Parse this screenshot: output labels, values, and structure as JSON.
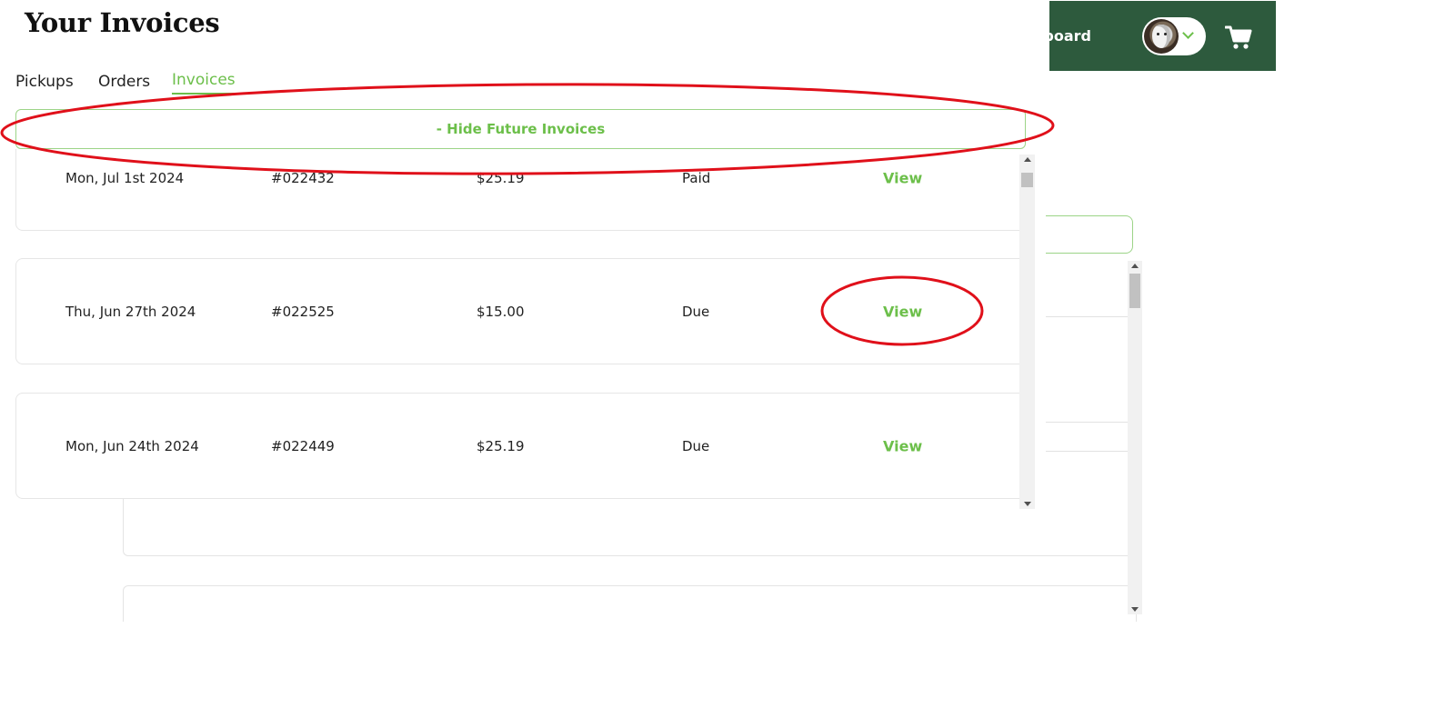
{
  "page": {
    "title": "Your Invoices"
  },
  "header": {
    "dashboard_link": "Dashboard",
    "icons": [
      "user-avatar",
      "chevron-down-icon",
      "shopping-cart-icon"
    ],
    "bg_color": "#2d5a3d"
  },
  "tabs": [
    {
      "label": "Pickups",
      "active": false
    },
    {
      "label": "Orders",
      "active": false
    },
    {
      "label": "Invoices",
      "active": true
    }
  ],
  "toggle": {
    "label": "- Hide Future Invoices"
  },
  "invoices": [
    {
      "date": "Mon, Jul 1st 2024",
      "number": "#022432",
      "amount": "$25.19",
      "status": "Paid",
      "action": "View"
    },
    {
      "date": "Thu, Jun 27th 2024",
      "number": "#022525",
      "amount": "$15.00",
      "status": "Due",
      "action": "View"
    },
    {
      "date": "Mon, Jun 24th 2024",
      "number": "#022449",
      "amount": "$25.19",
      "status": "Due",
      "action": "View"
    }
  ],
  "colors": {
    "accent": "#6cbf4a",
    "header": "#2d5a3d",
    "annotation": "#e0101a"
  }
}
